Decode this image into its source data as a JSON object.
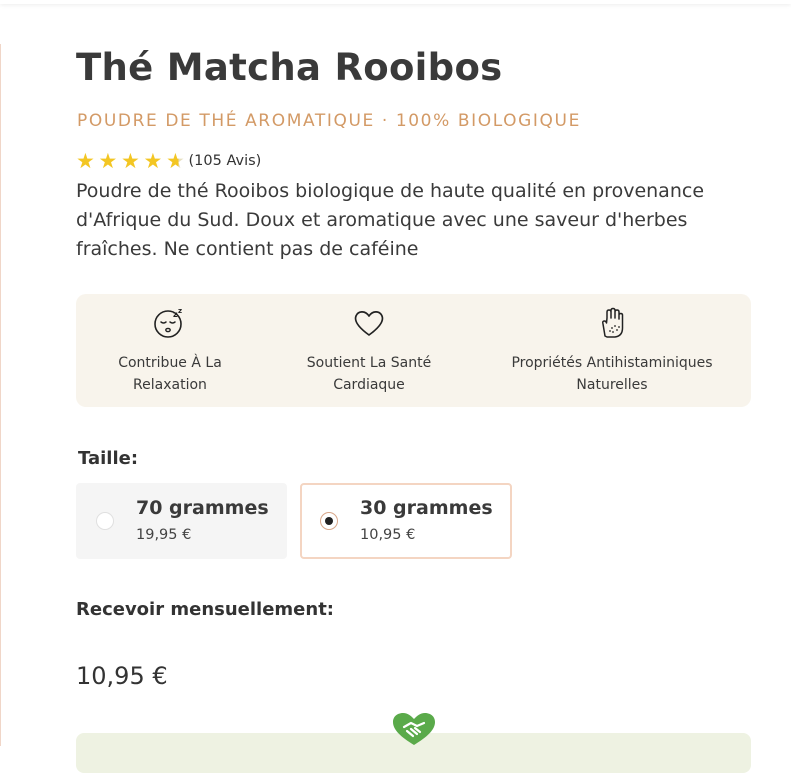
{
  "product": {
    "title": "Thé Matcha Rooibos",
    "subtitle": "POUDRE DE THÉ AROMATIQUE · 100% BIOLOGIQUE",
    "rating": 4.5,
    "reviews_label": "(105 Avis)",
    "description": "Poudre de thé Rooibos biologique de haute qualité en provenance d'Afrique du Sud. Doux et aromatique avec une saveur d'herbes fraîches. Ne contient pas de caféine"
  },
  "benefits": [
    {
      "icon": "relaxation-face-icon",
      "label_line1": "Contribue À La",
      "label_line2": "Relaxation"
    },
    {
      "icon": "heart-icon",
      "label_line1": "Soutient La Santé",
      "label_line2": "Cardiaque"
    },
    {
      "icon": "hand-icon",
      "label_line1": "Propriétés Antihistaminiques",
      "label_line2": "Naturelles"
    }
  ],
  "size": {
    "label": "Taille:",
    "options": [
      {
        "name": "70 grammes",
        "price": "19,95 €",
        "selected": false
      },
      {
        "name": "30 grammes",
        "price": "10,95 €",
        "selected": true
      }
    ]
  },
  "subscription": {
    "label": "Recevoir mensuellement:"
  },
  "price": "10,95 €",
  "colors": {
    "accent": "#d39a66",
    "star": "#f3c623",
    "benefit_bg": "#f8f4ec",
    "selected_border": "#f4d5c2",
    "subscribe_bg": "#eef2e2",
    "handshake": "#5aaa4a"
  }
}
